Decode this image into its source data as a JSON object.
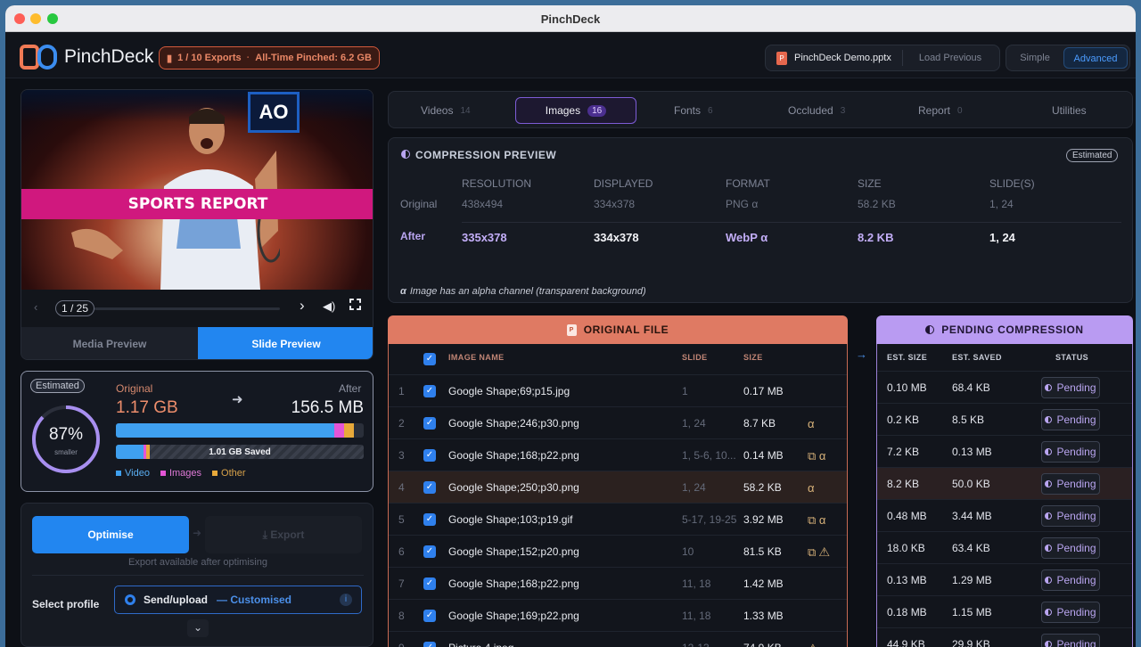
{
  "window": {
    "title": "PinchDeck"
  },
  "header": {
    "brand": "PinchDeck",
    "exports": "1 / 10 Exports",
    "all_time": "All-Time Pinched: 6.2 GB",
    "file": "PinchDeck Demo.pptx",
    "load_previous": "Load Previous",
    "simple": "Simple",
    "advanced": "Advanced"
  },
  "preview": {
    "slide_banner": "SPORTS REPORT",
    "slide_logo": "AO",
    "counter": "1 / 25",
    "media_tab": "Media Preview",
    "slide_tab": "Slide Preview"
  },
  "stats": {
    "estimated": "Estimated",
    "percent": "87%",
    "percent_label": "smaller",
    "original_label": "Original",
    "after_label": "After",
    "original": "1.17 GB",
    "after": "156.5 MB",
    "saved": "1.01 GB Saved",
    "legend": [
      "Video",
      "Images",
      "Other"
    ],
    "original_bar": {
      "video": 0.88,
      "images": 0.04,
      "other": 0.04
    },
    "after_bar": {
      "video": 0.11,
      "images": 0.012,
      "other": 0.015
    }
  },
  "actions": {
    "optimise": "Optimise",
    "export": "Export",
    "hint": "Export available after optimising",
    "profile_label": "Select profile",
    "profile": "Send/upload",
    "customised": "— Customised"
  },
  "tabs": [
    {
      "label": "Videos",
      "count": "14"
    },
    {
      "label": "Images",
      "count": "16"
    },
    {
      "label": "Fonts",
      "count": "6"
    },
    {
      "label": "Occluded",
      "count": "3"
    },
    {
      "label": "Report",
      "count": "0"
    },
    {
      "label": "Utilities",
      "count": ""
    }
  ],
  "compression": {
    "title": "COMPRESSION PREVIEW",
    "badge": "Estimated",
    "headers": [
      "RESOLUTION",
      "DISPLAYED",
      "FORMAT",
      "SIZE",
      "SLIDE(S)"
    ],
    "original_label": "Original",
    "after_label": "After",
    "original": [
      "438x494",
      "334x378",
      "PNG α",
      "58.2 KB",
      "1, 24"
    ],
    "after": [
      "335x378",
      "334x378",
      "WebP α",
      "8.2 KB",
      "1, 24"
    ],
    "note": "Image has an alpha channel (transparent background)",
    "note_icon": "α"
  },
  "original_file": {
    "title": "ORIGINAL FILE",
    "headers": [
      "IMAGE NAME",
      "SLIDE",
      "SIZE"
    ],
    "rows": [
      {
        "n": "1",
        "name": "Google Shape;69;p15.jpg",
        "slide": "1",
        "size": "0.17 MB",
        "flags": ""
      },
      {
        "n": "2",
        "name": "Google Shape;246;p30.png",
        "slide": "1, 24",
        "size": "8.7 KB",
        "flags": "α"
      },
      {
        "n": "3",
        "name": "Google Shape;168;p22.png",
        "slide": "1, 5-6, 10...",
        "size": "0.14 MB",
        "flags": "⧉ α"
      },
      {
        "n": "4",
        "name": "Google Shape;250;p30.png",
        "slide": "1, 24",
        "size": "58.2 KB",
        "flags": "α"
      },
      {
        "n": "5",
        "name": "Google Shape;103;p19.gif",
        "slide": "5-17, 19-25",
        "size": "3.92 MB",
        "flags": "⧉ α"
      },
      {
        "n": "6",
        "name": "Google Shape;152;p20.png",
        "slide": "10",
        "size": "81.5 KB",
        "flags": "⧉ ⚠"
      },
      {
        "n": "7",
        "name": "Google Shape;168;p22.png",
        "slide": "11, 18",
        "size": "1.42 MB",
        "flags": ""
      },
      {
        "n": "8",
        "name": "Google Shape;169;p22.png",
        "slide": "11, 18",
        "size": "1.33 MB",
        "flags": ""
      },
      {
        "n": "9",
        "name": "Picture 4.jpeg",
        "slide": "12-13",
        "size": "74.9 KB",
        "flags": "⚠"
      }
    ]
  },
  "pending": {
    "title": "PENDING COMPRESSION",
    "headers": [
      "EST. SIZE",
      "EST. SAVED",
      "STATUS"
    ],
    "rows": [
      {
        "size": "0.10 MB",
        "saved": "68.4 KB",
        "status": "Pending"
      },
      {
        "size": "0.2 KB",
        "saved": "8.5 KB",
        "status": "Pending"
      },
      {
        "size": "7.2 KB",
        "saved": "0.13 MB",
        "status": "Pending"
      },
      {
        "size": "8.2 KB",
        "saved": "50.0 KB",
        "status": "Pending"
      },
      {
        "size": "0.48 MB",
        "saved": "3.44 MB",
        "status": "Pending"
      },
      {
        "size": "18.0 KB",
        "saved": "63.4 KB",
        "status": "Pending"
      },
      {
        "size": "0.13 MB",
        "saved": "1.29 MB",
        "status": "Pending"
      },
      {
        "size": "0.18 MB",
        "saved": "1.15 MB",
        "status": "Pending"
      },
      {
        "size": "44.9 KB",
        "saved": "29.9 KB",
        "status": "Pending"
      }
    ]
  },
  "colors": {
    "accent": "#2f80ed",
    "purple": "#9b7be8",
    "orange": "#df7a63",
    "video": "#3fa0f0",
    "images": "#e455d6",
    "other": "#e8a93a"
  }
}
